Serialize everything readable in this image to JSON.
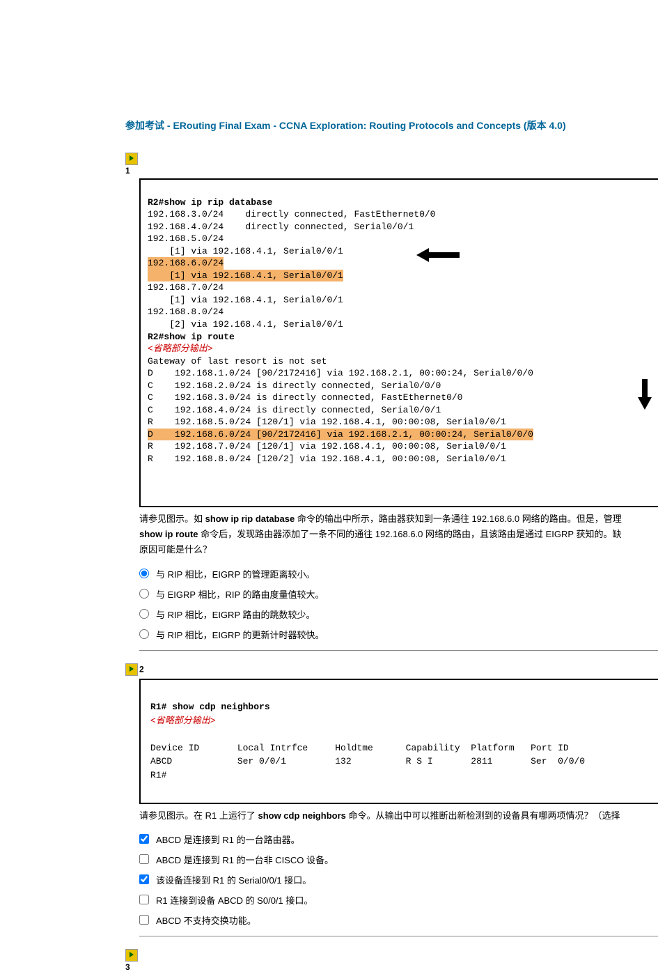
{
  "title": "参加考试 - ERouting Final Exam - CCNA Exploration: Routing Protocols and Concepts (版本 4.0)",
  "q1": {
    "num": "1",
    "exhibit": {
      "l1": "R2#show ip rip database",
      "l2": "192.168.3.0/24    directly connected, FastEthernet0/0",
      "l3": "192.168.4.0/24    directly connected, Serial0/0/1",
      "l4": "192.168.5.0/24",
      "l5": "    [1] via 192.168.4.1, Serial0/0/1",
      "l6": "192.168.6.0/24",
      "l7": "    [1] via 192.168.4.1, Serial0/0/1",
      "l8": "192.168.7.0/24",
      "l9": "    [1] via 192.168.4.1, Serial0/0/1",
      "l10": "192.168.8.0/24",
      "l11": "    [2] via 192.168.4.1, Serial0/0/1",
      "l12": "R2#show ip route",
      "l13": "<省略部分输出>",
      "l14": "Gateway of last resort is not set",
      "l15": "D    192.168.1.0/24 [90/2172416] via 192.168.2.1, 00:00:24, Serial0/0/0",
      "l16": "C    192.168.2.0/24 is directly connected, Serial0/0/0",
      "l17": "C    192.168.3.0/24 is directly connected, FastEthernet0/0",
      "l18": "C    192.168.4.0/24 is directly connected, Serial0/0/1",
      "l19": "R    192.168.5.0/24 [120/1] via 192.168.4.1, 00:00:08, Serial0/0/1",
      "l20": "D    192.168.6.0/24 [90/2172416] via 192.168.2.1, 00:00:24, Serial0/0/0",
      "l21": "R    192.168.7.0/24 [120/1] via 192.168.4.1, 00:00:08, Serial0/0/1",
      "l22": "R    192.168.8.0/24 [120/2] via 192.168.4.1, 00:00:08, Serial0/0/1"
    },
    "question_p1": "请参见图示。如 ",
    "question_cmd1": "show ip rip database",
    "question_p2": " 命令的输出中所示，路由器获知到一条通往 192.168.6.0 网络的路由。但是，管理",
    "question_cmd2": "show ip route",
    "question_p3": " 命令后，发现路由器添加了一条不同的通往 192.168.6.0 网络的路由，且该路由是通过 EIGRP 获知的。缺",
    "question_p4": "原因可能是什么？",
    "options": [
      "与 RIP 相比，EIGRP 的管理距离较小。",
      "与 EIGRP 相比，RIP 的路由度量值较大。",
      "与 RIP 相比，EIGRP 路由的跳数较少。",
      "与 RIP 相比，EIGRP 的更新计时器较快。"
    ],
    "selected": 0
  },
  "q2": {
    "num": "2",
    "exhibit": {
      "l1": "R1# show cdp neighbors",
      "l2": "<省略部分输出>",
      "hdr": "Device ID       Local Intrfce     Holdtme      Capability  Platform   Port ID",
      "row": "ABCD            Ser 0/0/1         132          R S I       2811       Ser  0/0/0",
      "l5": "R1#"
    },
    "question_p1": "请参见图示。在 R1 上运行了 ",
    "question_cmd": "show cdp neighbors",
    "question_p2": " 命令。从输出中可以推断出新检测到的设备具有哪两项情况？（选择",
    "options": [
      "ABCD 是连接到 R1 的一台路由器。",
      "ABCD 是连接到 R1 的一台非 CISCO 设备。",
      "该设备连接到 R1 的 Serial0/0/1 接口。",
      "R1 连接到设备 ABCD 的 S0/0/1 接口。",
      "ABCD 不支持交换功能。"
    ],
    "checked": [
      true,
      false,
      true,
      false,
      false
    ]
  },
  "q3": {
    "num": "3"
  }
}
